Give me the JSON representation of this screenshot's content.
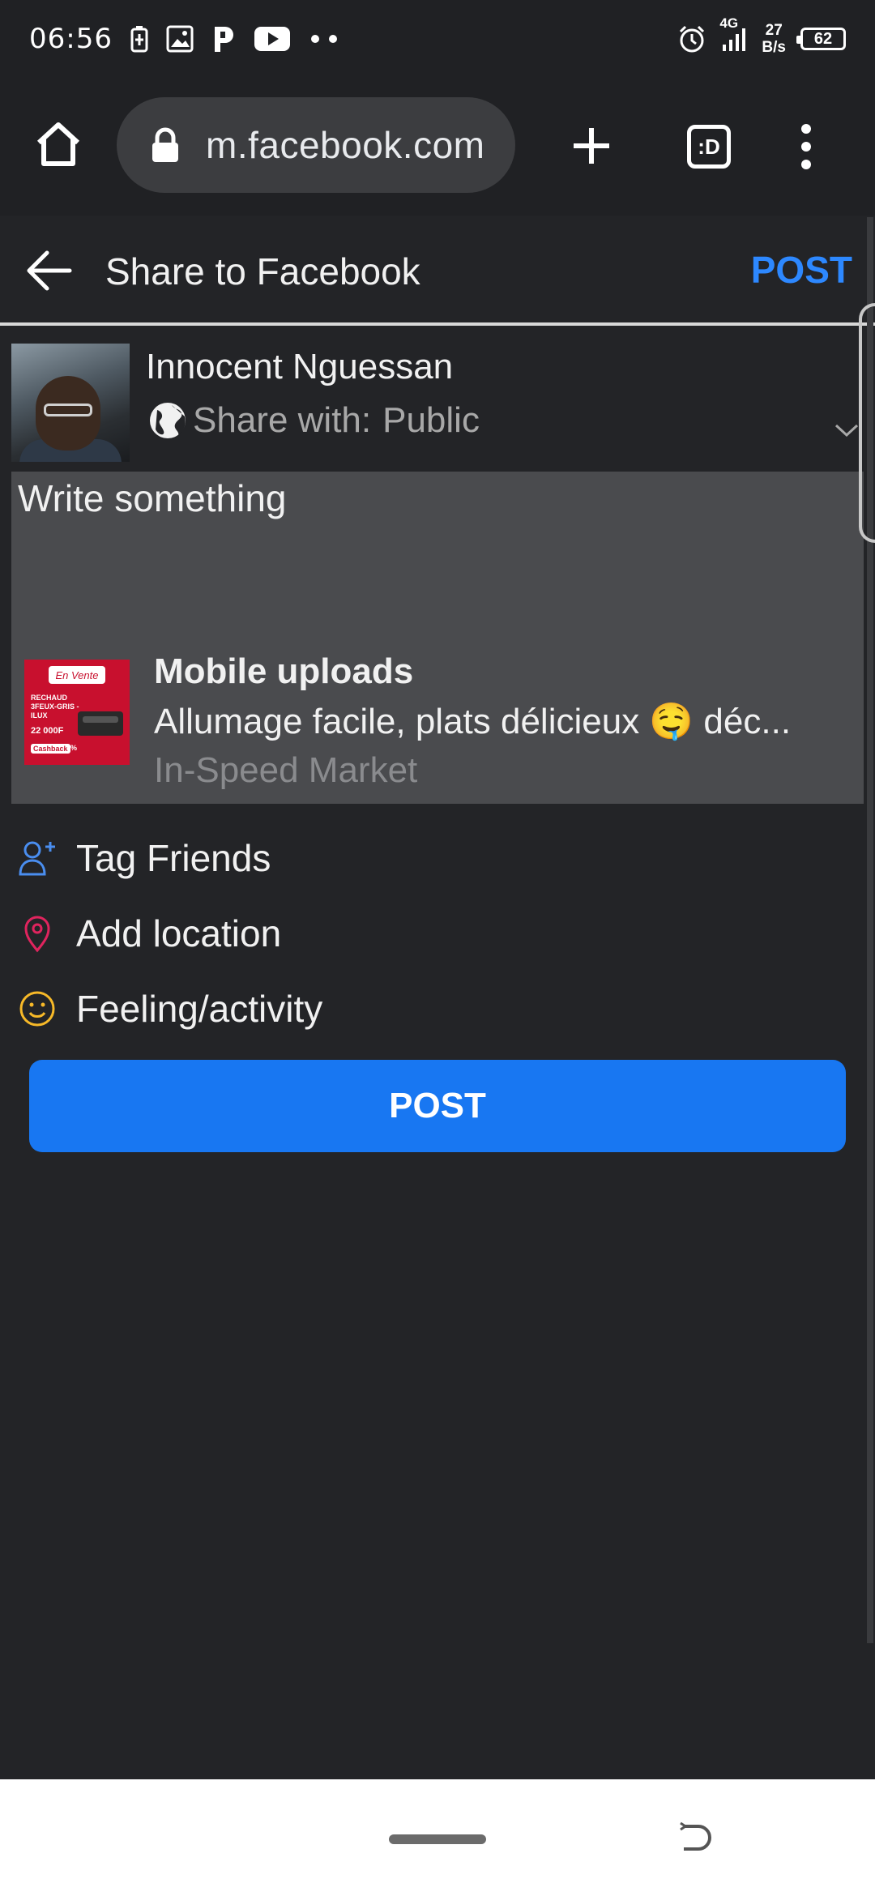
{
  "status_bar": {
    "time": "06:56",
    "network_type": "4G",
    "speed_value": "27",
    "speed_unit": "B/s",
    "battery": "62",
    "notification_icons": [
      "battery-charging-icon",
      "image-icon",
      "p-app-icon",
      "youtube-icon",
      "more-dots-icon"
    ],
    "system_icons": [
      "alarm-icon",
      "signal-icon"
    ]
  },
  "browser": {
    "url": "m.facebook.com",
    "tab_label": ":D",
    "icons": [
      "home-icon",
      "lock-icon",
      "plus-icon",
      "menu-dots-icon"
    ]
  },
  "header": {
    "title": "Share to Facebook",
    "post_label": "POST",
    "back_icon": "arrow-left-icon"
  },
  "composer": {
    "user_name": "Innocent Nguessan",
    "share_with_label": "Share with:",
    "share_with_value": "Public",
    "placeholder": "Write something",
    "attachment": {
      "title": "Mobile uploads",
      "description": "Allumage facile, plats délicieux 🤤 déc...",
      "source": "In-Speed Market",
      "thumb_text": {
        "tag": "En Vente",
        "line1": "RECHAUD 3FEUX-GRIS -ILUX",
        "price": "22 000F",
        "cashback": "Cashback",
        "percent": "5%"
      }
    }
  },
  "actions": [
    {
      "label": "Tag Friends",
      "icon": "add-person-icon",
      "color": "#4a8ef0"
    },
    {
      "label": "Add location",
      "icon": "location-pin-icon",
      "color": "#e0245e"
    },
    {
      "label": "Feeling/activity",
      "icon": "smiley-icon",
      "color": "#f7b928"
    }
  ],
  "post_button_label": "POST",
  "colors": {
    "accent": "#2d88ff",
    "button": "#1877f2",
    "background": "#232427"
  }
}
